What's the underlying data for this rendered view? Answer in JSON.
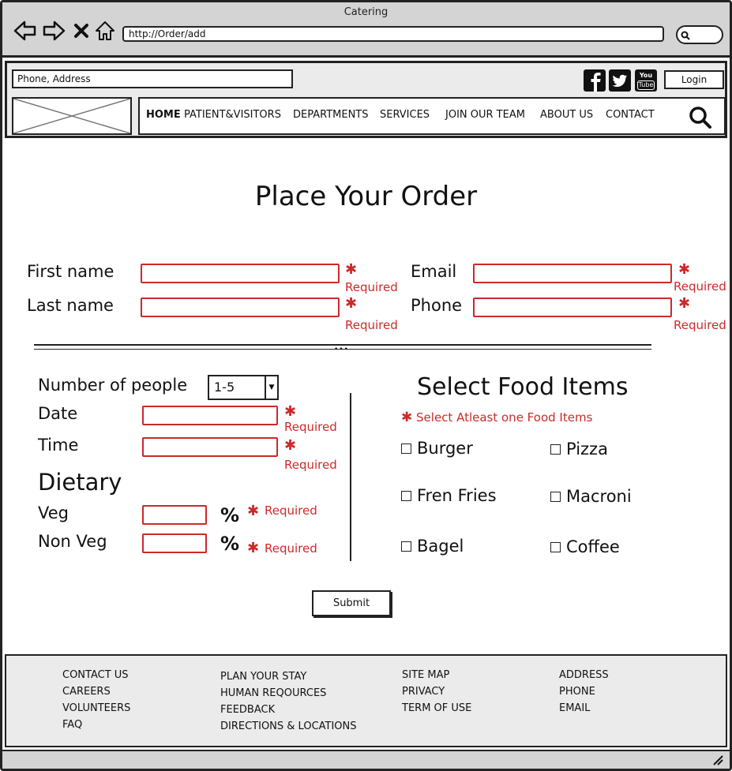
{
  "window": {
    "title": "Catering"
  },
  "browser": {
    "url": "http://Order/add"
  },
  "header": {
    "address_placeholder": "Phone, Address",
    "login_label": "Login",
    "social": [
      "facebook-icon",
      "twitter-icon",
      "youtube-icon"
    ],
    "youtube_text_1": "You",
    "youtube_text_2": "Tube"
  },
  "nav": {
    "items": [
      {
        "label": "HOME",
        "active": true
      },
      {
        "label": "PATIENT&VISITORS"
      },
      {
        "label": "DEPARTMENTS"
      },
      {
        "label": "SERVICES"
      },
      {
        "label": "JOIN OUR TEAM"
      },
      {
        "label": "ABOUT US"
      },
      {
        "label": "CONTACT"
      }
    ]
  },
  "form": {
    "title": "Place Your Order",
    "first_name_label": "First name",
    "last_name_label": "Last name",
    "email_label": "Email",
    "phone_label": "Phone",
    "required_text": "Required",
    "required_star": "✱",
    "people_label": "Number of people",
    "people_value": "1-5",
    "date_label": "Date",
    "time_label": "Time",
    "dietary_label": "Dietary",
    "veg_label": "Veg",
    "nonveg_label": "Non Veg",
    "percent": "%",
    "submit_label": "Submit"
  },
  "food": {
    "title": "Select Food Items",
    "requirement": "Select Atleast one Food Items",
    "items": [
      "Burger",
      "Pizza",
      "Fren Fries",
      "Macroni",
      "Bagel",
      "Coffee"
    ]
  },
  "footer": {
    "col1": [
      "CONTACT US",
      "CAREERS",
      "VOLUNTEERS",
      "FAQ"
    ],
    "col2": [
      "PLAN YOUR STAY",
      "HUMAN REQOURCES",
      "FEEDBACK",
      "DIRECTIONS & LOCATIONS"
    ],
    "col3": [
      "SITE MAP",
      "PRIVACY",
      "TERM OF USE"
    ],
    "col4": [
      "ADDRESS",
      "PHONE",
      "EMAIL"
    ]
  },
  "colors": {
    "required": "#cc2a2a",
    "chrome": "#d4d4d4",
    "panel": "#ebebeb"
  }
}
